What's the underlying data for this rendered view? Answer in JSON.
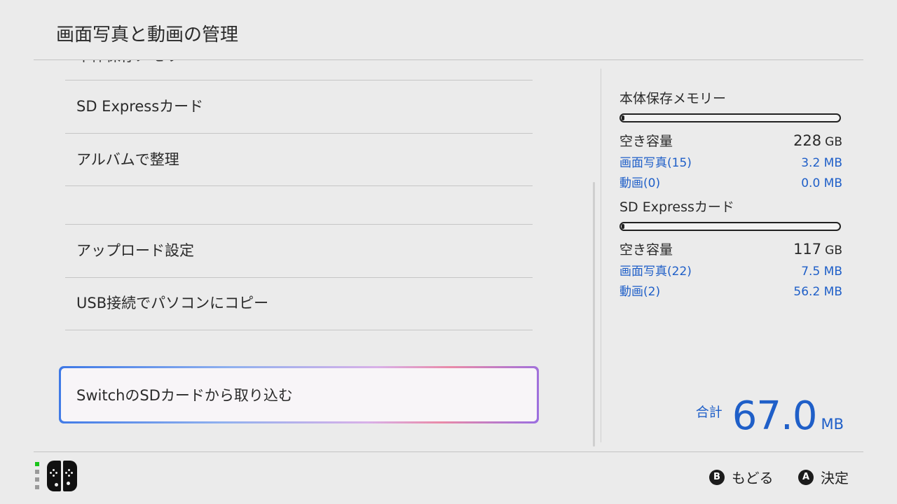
{
  "header": {
    "title": "画面写真と動画の管理"
  },
  "menu": {
    "partial_item": "本体保存メモリー",
    "items": [
      {
        "label": "SD Expressカード"
      },
      {
        "label": "アルバムで整理"
      },
      {
        "label": ""
      },
      {
        "label": "アップロード設定"
      },
      {
        "label": "USB接続でパソコンにコピー"
      }
    ],
    "selected_label": "SwitchのSDカードから取り込む"
  },
  "storage": [
    {
      "name": "本体保存メモリー",
      "usage_fraction": 0.01,
      "free_label": "空き容量",
      "free_value": "228",
      "free_unit": "GB",
      "screenshots_label": "画面写真(15)",
      "screenshots_size": "3.2 MB",
      "videos_label": "動画(0)",
      "videos_size": "0.0 MB"
    },
    {
      "name": "SD Expressカード",
      "usage_fraction": 0.01,
      "free_label": "空き容量",
      "free_value": "117",
      "free_unit": "GB",
      "screenshots_label": "画面写真(22)",
      "screenshots_size": "7.5 MB",
      "videos_label": "動画(2)",
      "videos_size": "56.2 MB"
    }
  ],
  "total": {
    "label": "合計",
    "value": "67.0",
    "unit": "MB"
  },
  "footer": {
    "back_key": "B",
    "back_label": "もどる",
    "confirm_key": "A",
    "confirm_label": "決定"
  },
  "colors": {
    "accent": "#1f5fc8",
    "indicator": "#19c419"
  }
}
